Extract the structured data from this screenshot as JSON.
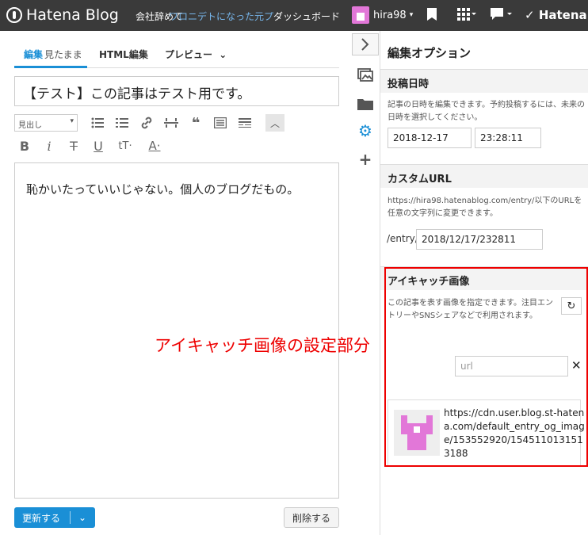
{
  "header": {
    "logo_text": "Hatena Blog",
    "blog_title": "会社辞めて",
    "blog_title_overlay": "ワロニデトになった元プ",
    "dashboard": "ダッシュボード",
    "user_name": "hira98",
    "brand": "Hatena"
  },
  "editor": {
    "tabs": [
      {
        "label": "編集",
        "sub": "見たまま"
      },
      {
        "label": "HTML編集"
      },
      {
        "label": "プレビュー"
      }
    ],
    "title": "【テスト】この記事はテスト用です。",
    "format_select": "見出し",
    "body": "恥かいたっていいじゃない。個人のブログだもの。",
    "update_label": "更新する",
    "delete_label": "削除する"
  },
  "panel": {
    "title": "編集オプション",
    "post_date": {
      "heading": "投稿日時",
      "description": "記事の日時を編集できます。予約投稿するには、未来の日時を選択してください。",
      "date": "2018-12-17",
      "time": "23:28:11"
    },
    "custom_url": {
      "heading": "カスタムURL",
      "description": "https://hira98.hatenablog.com/entry/以下のURLを任意の文字列に変更できます。",
      "prefix": "/entry/",
      "value": "2018/12/17/232811"
    },
    "eyecatch": {
      "heading": "アイキャッチ画像",
      "description": "この記事を表す画像を指定できます。注目エントリーやSNSシェアなどで利用されます。",
      "url_placeholder": "url",
      "image_url": "https://cdn.user.blog.st-hatena.com/default_entry_og_image/153552920/1545110131513188"
    }
  },
  "annotation": "アイキャッチ画像の設定部分",
  "colors": {
    "accent": "#1a8fd6",
    "annotation": "#ee0000",
    "avatar": "#e277d8"
  }
}
